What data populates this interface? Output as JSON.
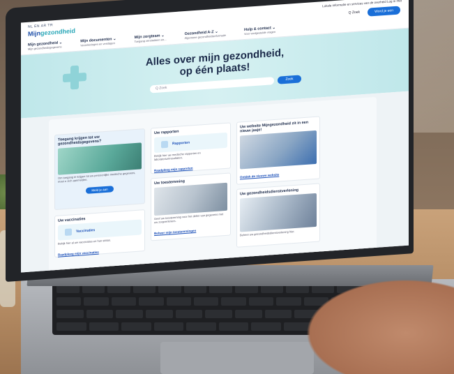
{
  "site": {
    "lang_links": "NL  EN  AR  TR",
    "logo_main": "Mijn",
    "logo_accent": "gezondheid",
    "top_notice": "Lokale informatie en services van de overheid   Log in met",
    "search_label": "Q  Zoek",
    "cta": "Word je een"
  },
  "nav": [
    {
      "label": "Mijn gezondheid ⌄",
      "sub": "Mijn gezondheidsgegevens"
    },
    {
      "label": "Mijn documenten ⌄",
      "sub": "Verzekeringen en verslagen"
    },
    {
      "label": "Mijn zorgteam ⌄",
      "sub": "Toegang verstrekken en..."
    },
    {
      "label": "Gezondheid A-Z ⌄",
      "sub": "Algemene gezondheidsinformatie"
    },
    {
      "label": "Hulp & contact ⌄",
      "sub": "Voor veelgestelde vragen"
    }
  ],
  "hero": {
    "title_line1": "Alles over mijn gezondheid,",
    "title_line2": "op één plaats!",
    "search_placeholder": "Q  Zoek",
    "search_button": "Zoek"
  },
  "cards": {
    "access": {
      "title": "Toegang krijgen tot uw gezondheidsgegevens?",
      "text": "Om toegang te krijgen tot uw persoonlijke medische gegevens, moet u zich aanmelden.",
      "button": "Meld je aan"
    },
    "reports": {
      "title": "Uw rapporten",
      "inner": "Rapporten",
      "text": "Bekijk hier uw medische rapporten en laboratoriumresultaten.",
      "link": "Raadpleeg mijn rapporten"
    },
    "website": {
      "title": "Uw website Mijngezondheid zit in een nieuw jasje!",
      "link": "Ontdek de nieuwe website"
    },
    "vaccines": {
      "title": "Uw vaccinaties",
      "inner": "Vaccinaties",
      "text": "Bekijk hier al uw vaccinaties en hun status.",
      "link": "Raadpleeg mijn vaccinaties"
    },
    "consent": {
      "title": "Uw toestemming",
      "text": "Geef uw toestemming voor het delen van gegevens met uw zorgverleners.",
      "link": "Beheer mijn toestemmingen"
    },
    "relationship": {
      "title": "Uw gezondheidsdienstverlening",
      "text": "Beheer uw gezondheidsdienstverlening hier."
    }
  },
  "colors": {
    "primary": "#1a6fd8",
    "hero_bg": "#bfe7ea",
    "heading": "#1b2a4a"
  }
}
